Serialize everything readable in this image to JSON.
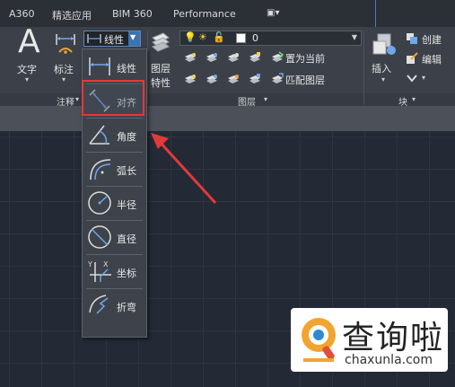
{
  "tabs": [
    "A360",
    "精选应用",
    "BIM 360",
    "Performance"
  ],
  "tab_overflow_icon": "caret-down-icon",
  "annotation_panel": {
    "text_label": "文字",
    "dimension_label": "标注",
    "title": "注释",
    "dim_style_value": "线性"
  },
  "layer_panel": {
    "properties_label_line1": "图层",
    "properties_label_line2": "特性",
    "current_layer": "0",
    "set_current_label": "置为当前",
    "match_layer_label": "匹配图层",
    "title": "图层"
  },
  "block_panel": {
    "insert_label": "插入",
    "create_label": "创建",
    "edit_label": "编辑",
    "title": "块"
  },
  "dimension_menu": {
    "items": [
      {
        "label": "线性",
        "icon": "linear-dimension-icon"
      },
      {
        "label": "对齐",
        "icon": "aligned-dimension-icon"
      },
      {
        "label": "角度",
        "icon": "angular-dimension-icon"
      },
      {
        "label": "弧长",
        "icon": "arc-length-dimension-icon"
      },
      {
        "label": "半径",
        "icon": "radius-dimension-icon"
      },
      {
        "label": "直径",
        "icon": "diameter-dimension-icon"
      },
      {
        "label": "坐标",
        "icon": "ordinate-dimension-icon"
      },
      {
        "label": "折弯",
        "icon": "jogged-dimension-icon"
      }
    ],
    "highlighted_item": "对齐"
  },
  "annotation_arrow_color": "#e23a3a",
  "watermark": {
    "title": "查询啦",
    "url": "chaxunla.com"
  },
  "colors": {
    "accent": "#3c73b0",
    "highlight": "#e23a3a",
    "canvas": "#232a35"
  }
}
